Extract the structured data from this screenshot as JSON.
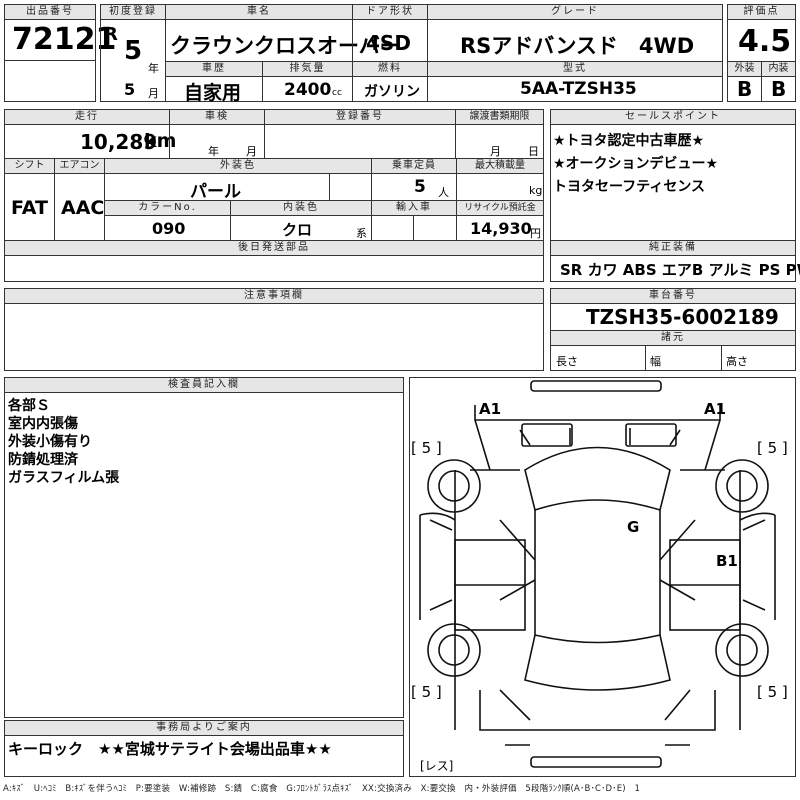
{
  "header": {
    "lot_label": "出品番号",
    "lot": "72121",
    "reg_label": "初度登録",
    "era": "R",
    "year": "5",
    "year_unit": "年",
    "month": "5",
    "month_unit": "月",
    "car_label": "車名",
    "car_name": "クラウンクロスオーバー",
    "door_label": "ドア形状",
    "door": "4SD",
    "grade_label": "グレード",
    "grade": "RSアドバンスド　4WD",
    "score_label": "評価点",
    "score": "4.5",
    "ext_label": "外装",
    "ext_grade": "B",
    "int_label": "内装",
    "int_grade": "B",
    "history_label": "車歴",
    "history": "自家用",
    "disp_label": "排気量",
    "disp": "2400",
    "disp_unit": "cc",
    "fuel_label": "燃料",
    "fuel": "ガソリン",
    "model_label": "型式",
    "model": "5AA-TZSH35"
  },
  "row2": {
    "mileage_label": "走行",
    "mileage": "10,289",
    "mileage_unit": "km",
    "inspection_label": "車検",
    "insp_year_unit": "年",
    "insp_month_unit": "月",
    "plate_label": "登録番号",
    "transfer_label": "譲渡書類期限",
    "transfer_month_unit": "月",
    "transfer_day_unit": "日",
    "shift_label": "シフト",
    "shift": "FAT",
    "ac_label": "エアコン",
    "ac": "AAC",
    "color_label": "外装色",
    "color": "パール",
    "seats_label": "乗車定員",
    "seats": "5",
    "seats_unit": "人",
    "load_label": "最大積載量",
    "load_unit": "kg",
    "colorno_label": "カラーNo.",
    "colorno": "090",
    "intcolor_label": "内装色",
    "intcolor": "クロ",
    "intcolor_unit": "系",
    "import_label": "輸入車",
    "recycle_label": "リサイクル預託金",
    "recycle": "14,930",
    "recycle_unit": "円"
  },
  "sales": {
    "label": "セールスポイント",
    "points": [
      "★トヨタ認定中古車歴★",
      "★オークションデビュー★",
      "トヨタセーフティセンス"
    ]
  },
  "later_parts": {
    "label": "後日発送部品"
  },
  "equipment": {
    "label": "純正装備",
    "value": "SR カワ ABS エアB アルミ PS PW"
  },
  "notice": {
    "label": "注意事項欄"
  },
  "chassis": {
    "label": "車台番号",
    "value": "TZSH35-6002189",
    "dims_label": "諸元",
    "length": "長さ",
    "width": "幅",
    "height": "高さ"
  },
  "inspector": {
    "label": "検査員記入欄",
    "notes": [
      "各部Ｓ",
      "室内内張傷",
      "外装小傷有り",
      "防錆処理済",
      "ガラスフィルム張"
    ]
  },
  "diagram": {
    "marks": [
      "A1",
      "A1",
      "G",
      "B1"
    ],
    "tires": [
      "[ 5 ]",
      "[ 5 ]",
      "[ 5 ]",
      "[ 5 ]"
    ],
    "spare": "[レス]"
  },
  "office": {
    "label": "事務局よりご案内",
    "text": "キーロック　★★宮城サテライト会場出品車★★"
  },
  "legend": "A:ｷｽﾞ　U:ﾍｺﾐ　B:ｷｽﾞを伴うﾍｺﾐ　P:要塗装　W:補修跡　S:錆　C:腐食　G:ﾌﾛﾝﾄｶﾞﾗｽ点ｷｽﾞ　XX:交換済み　X:要交換　内・外装評価　5段階ﾗﾝｸ順(A･B･C･D･E)　1"
}
